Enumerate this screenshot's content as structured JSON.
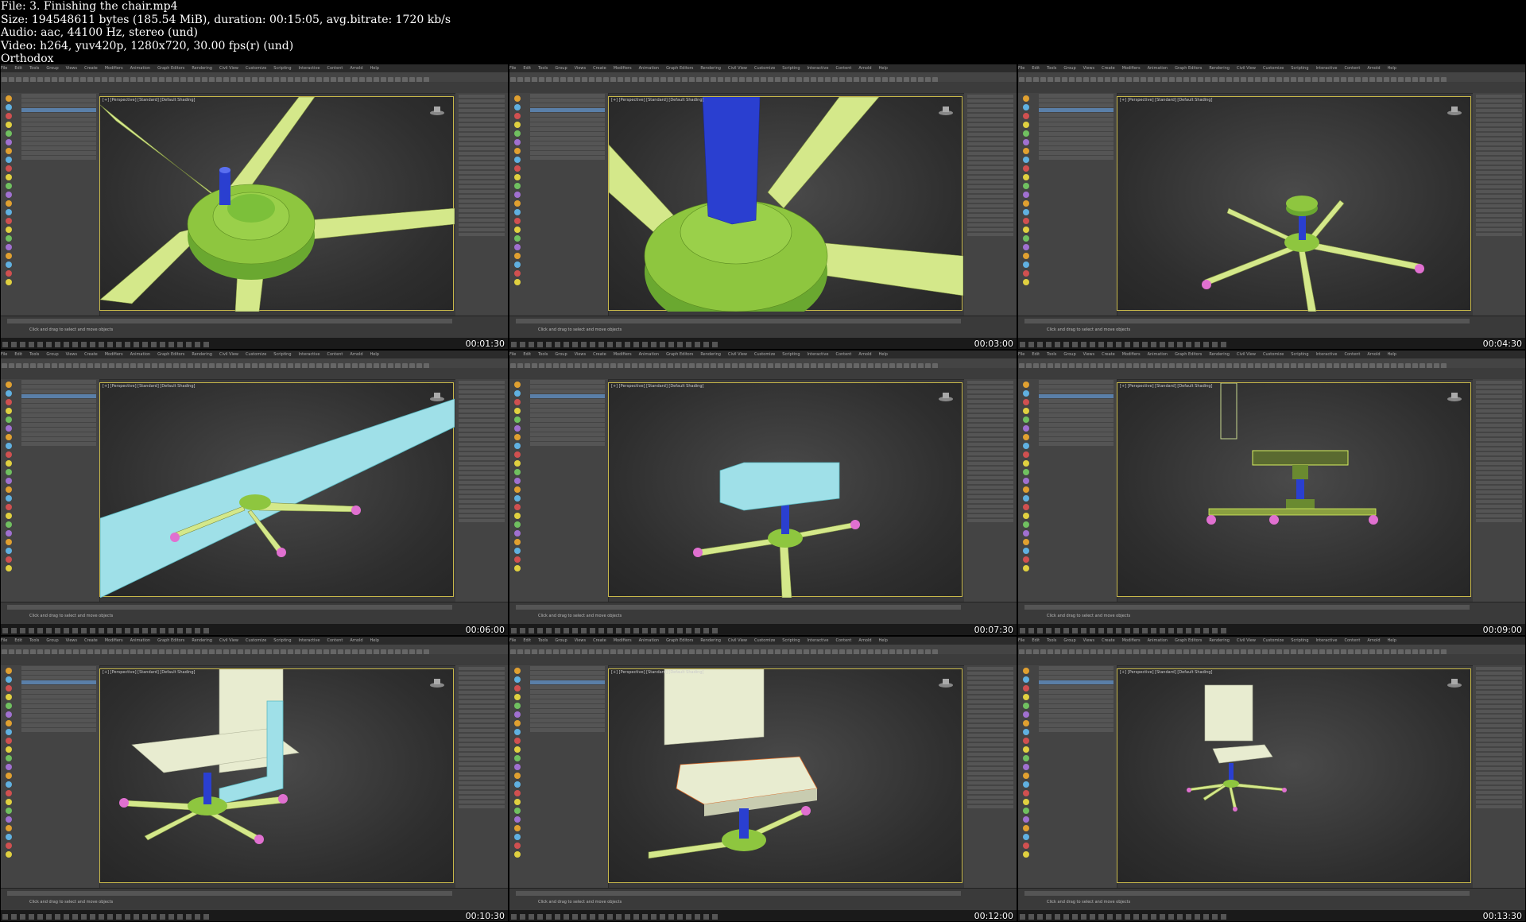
{
  "header": {
    "file": "File: 3. Finishing the chair.mp4",
    "size": "Size: 194548611 bytes (185.54 MiB), duration: 00:15:05, avg.bitrate: 1720 kb/s",
    "audio": "Audio: aac, 44100 Hz, stereo (und)",
    "video": "Video: h264, yuv420p, 1280x720, 30.00 fps(r) (und)",
    "author": "Orthodox"
  },
  "app": {
    "menu_items": [
      "File",
      "Edit",
      "Tools",
      "Group",
      "Views",
      "Create",
      "Modifiers",
      "Animation",
      "Graph Editors",
      "Rendering",
      "Civil View",
      "Customize",
      "Scripting",
      "Interactive",
      "Content",
      "Arnold",
      "Help"
    ],
    "viewport_label": "[+] [Perspective] [Standard] [Default Shading]",
    "status_prompt": "Click and drag to select and move objects"
  },
  "colors": {
    "legs": "#d4e88a",
    "base": "#8ec63f",
    "pole": "#2a3fd0",
    "caster": "#e070d0",
    "seat": "#e8ecd0",
    "selection": "#9fe0e8"
  },
  "tiles": [
    {
      "timestamp": "00:01:30"
    },
    {
      "timestamp": "00:03:00"
    },
    {
      "timestamp": "00:04:30"
    },
    {
      "timestamp": "00:06:00"
    },
    {
      "timestamp": "00:07:30"
    },
    {
      "timestamp": "00:09:00"
    },
    {
      "timestamp": "00:10:30"
    },
    {
      "timestamp": "00:12:00"
    },
    {
      "timestamp": "00:13:30"
    }
  ]
}
